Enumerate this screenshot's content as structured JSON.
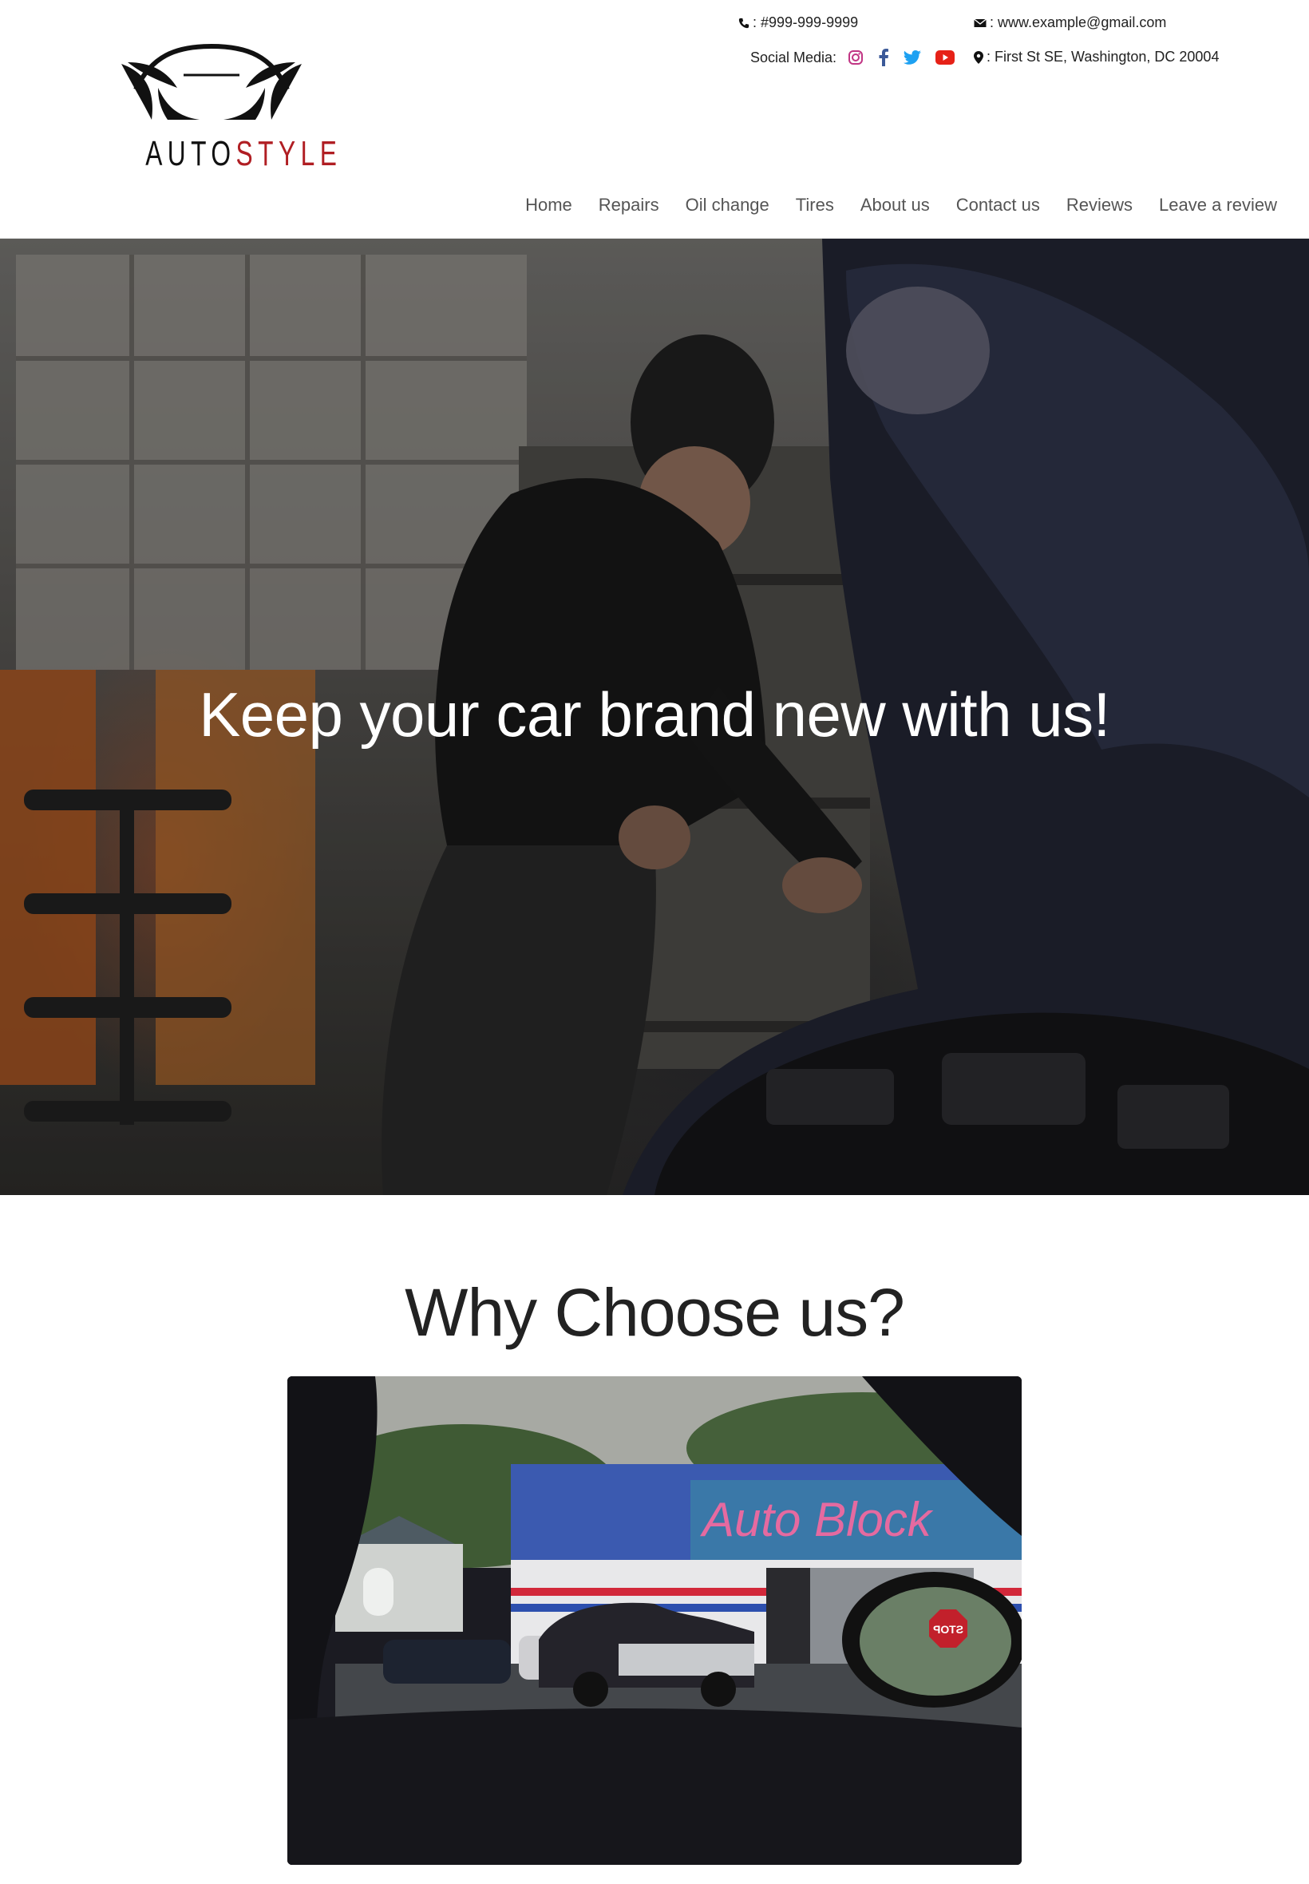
{
  "header": {
    "logo": {
      "word_part1": "AUTO",
      "word_part2": "STYLE"
    },
    "contact": {
      "phone": ": #999-999-9999",
      "email": ": www.example@gmail.com",
      "social_label": "Social Media:",
      "address": ": First St SE, Washington, DC 20004"
    },
    "social_icons": [
      "instagram-icon",
      "facebook-icon",
      "twitter-icon",
      "youtube-icon"
    ],
    "nav": [
      {
        "label": "Home"
      },
      {
        "label": "Repairs"
      },
      {
        "label": "Oil change"
      },
      {
        "label": "Tires"
      },
      {
        "label": "About us"
      },
      {
        "label": "Contact us"
      },
      {
        "label": "Reviews"
      },
      {
        "label": "Leave a review"
      }
    ]
  },
  "hero": {
    "headline": "Keep your car brand new with us!"
  },
  "why": {
    "heading": "Why Choose us?",
    "photo_sign": "Auto Block",
    "stop_sign": "STOP"
  },
  "colors": {
    "brand_red": "#b01e23",
    "instagram": "#c13584",
    "facebook": "#3b5998",
    "twitter": "#1da1f2",
    "youtube": "#e62117"
  }
}
